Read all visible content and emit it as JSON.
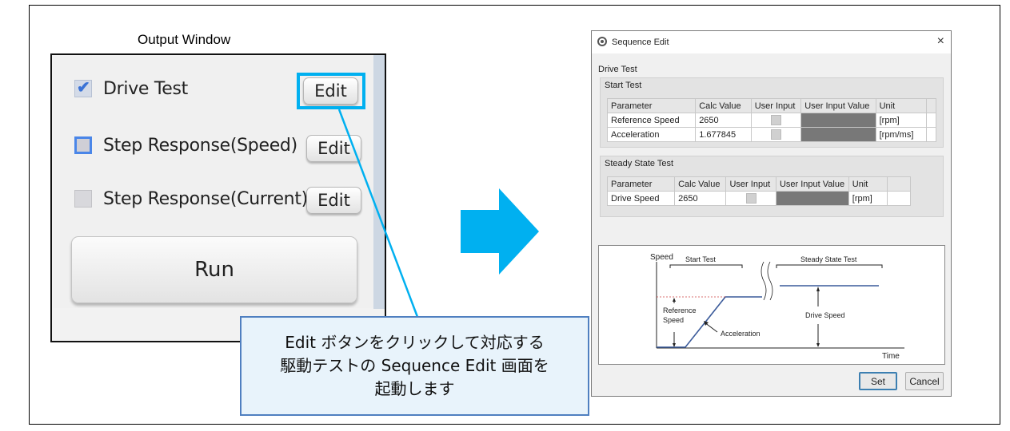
{
  "output_window": {
    "title": "Output Window",
    "items": [
      {
        "label": "Drive Test",
        "checked": true,
        "edit_label": "Edit"
      },
      {
        "label": "Step Response(Speed)",
        "checked": false,
        "edit_label": "Edit"
      },
      {
        "label": "Step Response(Current)",
        "checked": false,
        "edit_label": "Edit"
      }
    ],
    "run_label": "Run",
    "check_mark": "✔"
  },
  "callout": {
    "lines": [
      "Edit ボタンをクリックして対応する",
      "駆動テストの Sequence Edit 画面を",
      "起動します"
    ]
  },
  "dialog": {
    "title": "Sequence Edit",
    "close_label": "×",
    "section_title": "Drive Test",
    "start_test": {
      "title": "Start Test",
      "headers": [
        "Parameter",
        "Calc Value",
        "User Input",
        "User Input Value",
        "Unit"
      ],
      "rows": [
        {
          "parameter": "Reference Speed",
          "calc_value": "2650",
          "unit": "[rpm]"
        },
        {
          "parameter": "Acceleration",
          "calc_value": "1.677845",
          "unit": "[rpm/ms]"
        }
      ]
    },
    "steady_state_test": {
      "title": "Steady State Test",
      "headers": [
        "Parameter",
        "Calc Value",
        "User Input",
        "User Input Value",
        "Unit"
      ],
      "rows": [
        {
          "parameter": "Drive Speed",
          "calc_value": "2650",
          "unit": "[rpm]"
        }
      ]
    },
    "diagram": {
      "speed_label": "Speed",
      "time_label": "Time",
      "start_test_label": "Start Test",
      "steady_state_label": "Steady State Test",
      "reference_speed_label_1": "Reference",
      "reference_speed_label_2": "Speed",
      "acceleration_label": "Acceleration",
      "drive_speed_label": "Drive Speed"
    },
    "set_label": "Set",
    "cancel_label": "Cancel"
  },
  "colors": {
    "highlight": "#00b0f0",
    "arrow": "#00b0f0",
    "callout_border": "#4f7fc0",
    "plot_line": "#3a5a9a"
  }
}
